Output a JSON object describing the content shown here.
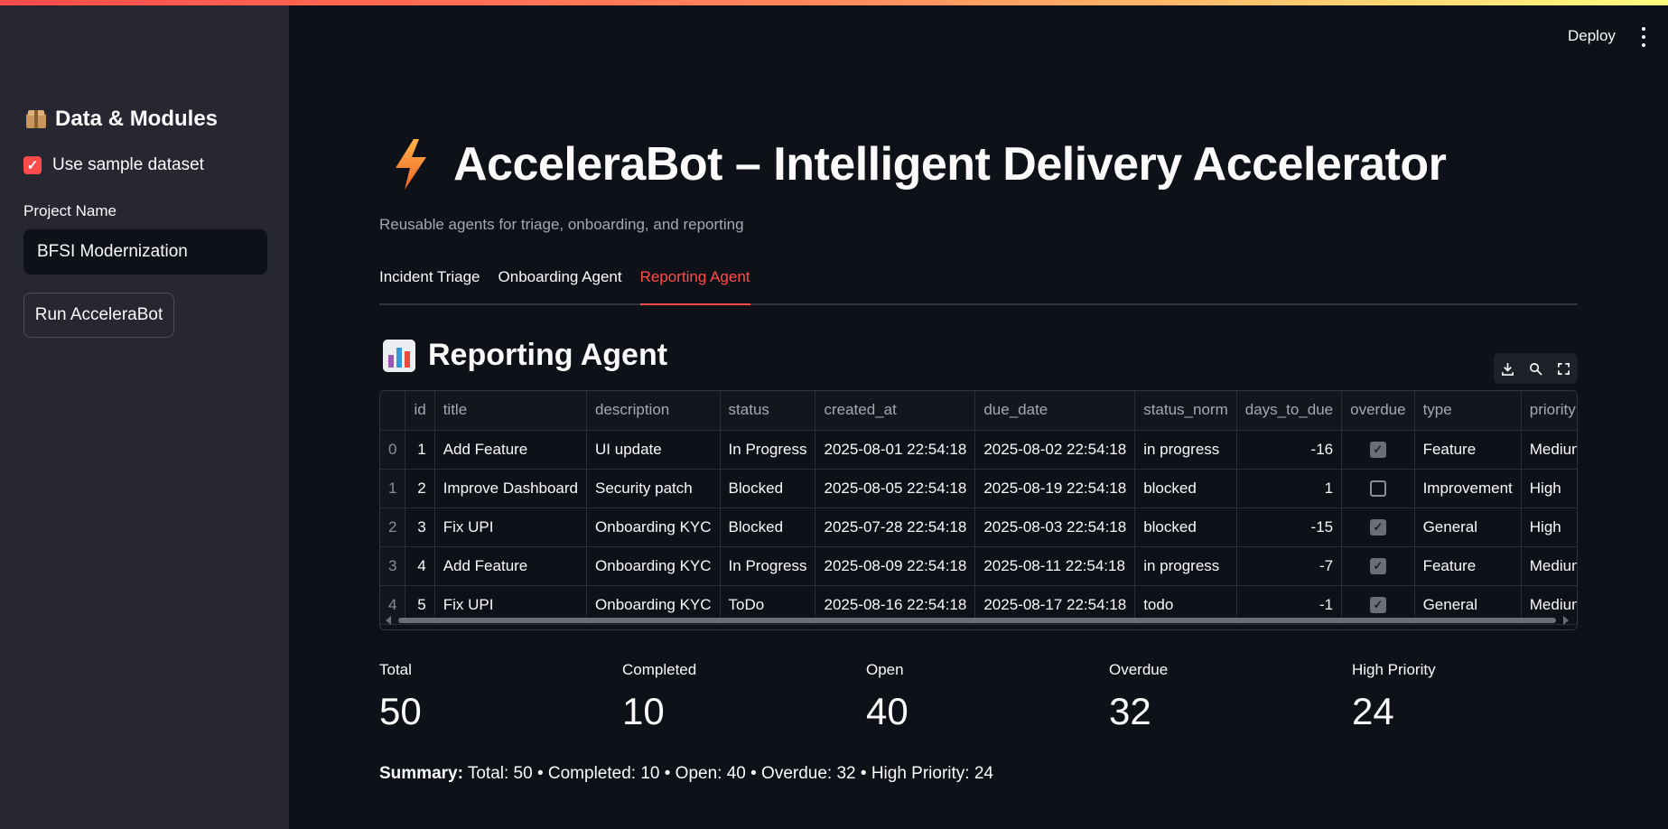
{
  "colors": {
    "accent": "#ff4b4b",
    "background": "#0e1117",
    "sidebar": "#262730"
  },
  "sidebar": {
    "header_icon": "package-icon",
    "header": "Data & Modules",
    "use_sample_label": "Use sample dataset",
    "use_sample_checked": true,
    "project_name_label": "Project Name",
    "project_name_value": "BFSI Modernization",
    "run_button": "Run AcceleraBot"
  },
  "header": {
    "deploy": "Deploy",
    "menu_icon": "kebab-menu-icon"
  },
  "main": {
    "title_icon": "lightning-icon",
    "title": "AcceleraBot – Intelligent Delivery Accelerator",
    "subtitle": "Reusable agents for triage, onboarding, and reporting",
    "tabs": [
      {
        "label": "Incident Triage",
        "active": false
      },
      {
        "label": "Onboarding Agent",
        "active": false
      },
      {
        "label": "Reporting Agent",
        "active": true
      }
    ],
    "section_icon": "bar-chart-icon",
    "section_title": "Reporting Agent",
    "toolbar_icons": [
      "download-icon",
      "search-icon",
      "fullscreen-icon"
    ]
  },
  "table": {
    "columns": [
      "",
      "id",
      "title",
      "description",
      "status",
      "created_at",
      "due_date",
      "status_norm",
      "days_to_due",
      "overdue",
      "type",
      "priority"
    ],
    "rows": [
      [
        "0",
        "1",
        "Add Feature",
        "UI update",
        "In Progress",
        "2025-08-01 22:54:18",
        "2025-08-02 22:54:18",
        "in progress",
        "-16",
        true,
        "Feature",
        "Medium"
      ],
      [
        "1",
        "2",
        "Improve Dashboard",
        "Security patch",
        "Blocked",
        "2025-08-05 22:54:18",
        "2025-08-19 22:54:18",
        "blocked",
        "1",
        false,
        "Improvement",
        "High"
      ],
      [
        "2",
        "3",
        "Fix UPI",
        "Onboarding KYC",
        "Blocked",
        "2025-07-28 22:54:18",
        "2025-08-03 22:54:18",
        "blocked",
        "-15",
        true,
        "General",
        "High"
      ],
      [
        "3",
        "4",
        "Add Feature",
        "Onboarding KYC",
        "In Progress",
        "2025-08-09 22:54:18",
        "2025-08-11 22:54:18",
        "in progress",
        "-7",
        true,
        "Feature",
        "Medium"
      ],
      [
        "4",
        "5",
        "Fix UPI",
        "Onboarding KYC",
        "ToDo",
        "2025-08-16 22:54:18",
        "2025-08-17 22:54:18",
        "todo",
        "-1",
        true,
        "General",
        "Medium"
      ]
    ]
  },
  "metrics": [
    {
      "label": "Total",
      "value": "50"
    },
    {
      "label": "Completed",
      "value": "10"
    },
    {
      "label": "Open",
      "value": "40"
    },
    {
      "label": "Overdue",
      "value": "32"
    },
    {
      "label": "High Priority",
      "value": "24"
    }
  ],
  "summary": {
    "label": "Summary:",
    "text": " Total: 50 • Completed: 10 • Open: 40 • Overdue: 32 • High Priority: 24"
  }
}
